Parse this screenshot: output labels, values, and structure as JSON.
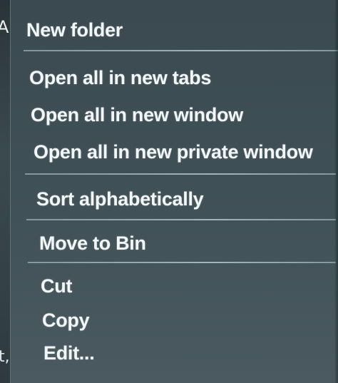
{
  "menu": {
    "new_folder": "New folder",
    "open_all_new_tabs": "Open all in new tabs",
    "open_all_new_window": "Open all in new window",
    "open_all_private_window": "Open all in new private window",
    "sort_alphabetically": "Sort alphabetically",
    "move_to_bin": "Move to Bin",
    "cut": "Cut",
    "copy": "Copy",
    "edit": "Edit..."
  },
  "left_glyphs": {
    "top": "A",
    "bottom": "t,"
  },
  "colors": {
    "menu_background": "#3f5056",
    "text": "#f2f6f7",
    "separator": "#b6c6ca"
  }
}
